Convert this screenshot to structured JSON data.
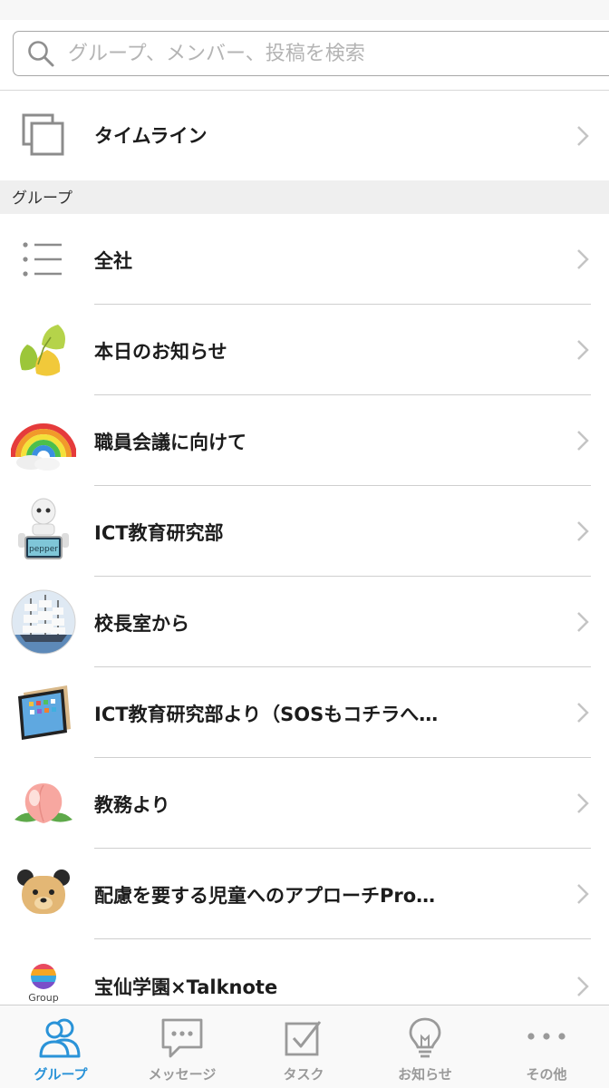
{
  "search": {
    "placeholder": "グループ、メンバー、投稿を検索",
    "icon": "search-icon"
  },
  "timeline": {
    "label": "タイムライン",
    "icon": "stacked-squares-icon"
  },
  "section": {
    "groups_header": "グループ"
  },
  "groups": [
    {
      "label": "全社",
      "icon": "list-icon"
    },
    {
      "label": "本日のお知らせ",
      "icon": "ginkgo-leaf-icon"
    },
    {
      "label": "職員会議に向けて",
      "icon": "rainbow-icon"
    },
    {
      "label": "ICT教育研究部",
      "icon": "pepper-robot-icon",
      "thumb_text": "pepper"
    },
    {
      "label": "校長室から",
      "icon": "sailing-ship-icon"
    },
    {
      "label": "ICT教育研究部より（SOSもコチラへ…",
      "icon": "tablet-icon"
    },
    {
      "label": "教務より",
      "icon": "peach-icon"
    },
    {
      "label": "配慮を要する児童へのアプローチPro…",
      "icon": "bear-icon"
    },
    {
      "label": "宝仙学園×Talknote",
      "icon": "group-logo-icon",
      "thumb_text": "Group"
    }
  ],
  "tabbar": {
    "active_color": "#2a93d8",
    "inactive_color": "#9a9a9a",
    "tabs": [
      {
        "label": "グループ",
        "icon": "people-icon",
        "active": true
      },
      {
        "label": "メッセージ",
        "icon": "chat-bubble-icon",
        "active": false
      },
      {
        "label": "タスク",
        "icon": "checkbox-icon",
        "active": false
      },
      {
        "label": "お知らせ",
        "icon": "lightbulb-icon",
        "active": false
      },
      {
        "label": "その他",
        "icon": "more-dots-icon",
        "active": false
      }
    ]
  }
}
